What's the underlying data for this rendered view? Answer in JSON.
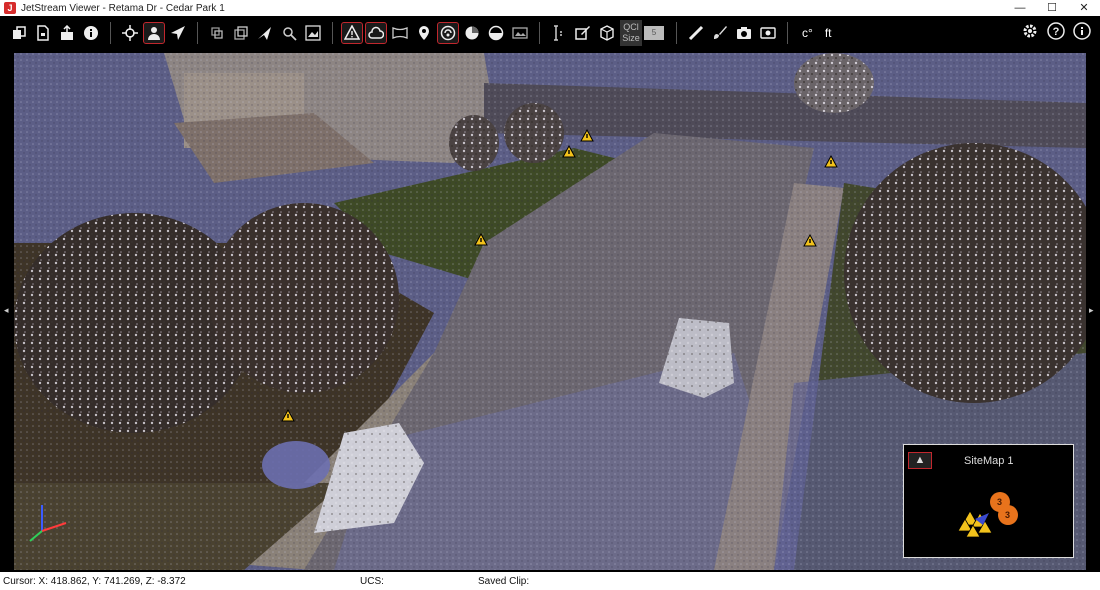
{
  "window": {
    "title": "JetStream Viewer - Retama Dr - Cedar Park 1",
    "minimize": "—",
    "maximize": "☐",
    "close": "✕"
  },
  "toolbar": {
    "groups": [
      [
        "open-icon",
        "document-icon",
        "export-icon",
        "info-icon"
      ],
      [
        "target-icon",
        "person-view-icon",
        "send-icon"
      ],
      [
        "layers-icon",
        "stack-icon",
        "satellite-icon",
        "search-icon",
        "images-icon"
      ],
      [
        "warning-triangle-icon",
        "cloud-icon",
        "panorama-icon",
        "pin-icon",
        "globe-icon",
        "chart-icon",
        "contrast-icon",
        "photo-icon"
      ],
      [
        "measure-height-icon",
        "edit-box-icon",
        "cube-icon"
      ],
      [
        "ruler-icon",
        "brush-icon",
        "camera-icon",
        "video-icon"
      ]
    ],
    "qclip_label": "QCl Size",
    "qclip_value": "5",
    "temp_unit": "c°",
    "length_unit": "ft"
  },
  "right_tools": [
    "settings-icon",
    "help-icon",
    "info-icon"
  ],
  "viewport": {
    "left_arrow": "◂",
    "right_arrow": "▸"
  },
  "sitemap": {
    "title": "SiteMap 1",
    "marker_count_1": "3",
    "marker_count_2": "3"
  },
  "status": {
    "cursor": "Cursor: X: 418.862, Y: 741.269, Z: -8.372",
    "ucs": "UCS:",
    "saved_clip": "Saved Clip:"
  },
  "colors": {
    "accent": "#c1272d",
    "marker_yellow": "#f2c21b",
    "sky": "#5f6189",
    "marker_orange": "#e8731c"
  }
}
